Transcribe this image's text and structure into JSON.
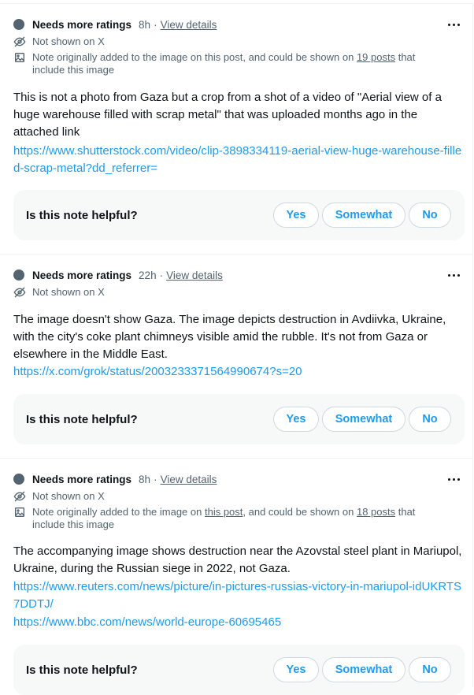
{
  "notes": [
    {
      "status": "Needs more ratings",
      "time": "8h",
      "sep": "·",
      "view_details": "View details",
      "not_shown": "Not shown on X",
      "media_prefix": "Note originally added to the image on this post, and could be shown on ",
      "media_link": "19 posts",
      "media_suffix": " that include this image",
      "body": "This is not a photo from Gaza but a crop from a shot of a video of \"Aerial view of a huge warehouse filled with scrap metal\" that was uploaded months ago in the attached link",
      "links": [
        "https://www.shutterstock.com/video/clip-3898334119-aerial-view-huge-warehouse-filled-scrap-metal?dd_referrer="
      ],
      "question": "Is this note helpful?",
      "yes": "Yes",
      "somewhat": "Somewhat",
      "no": "No"
    },
    {
      "status": "Needs more ratings",
      "time": "22h",
      "sep": "·",
      "view_details": "View details",
      "not_shown": "Not shown on X",
      "body": "The image doesn't show Gaza. The image depicts destruction in Avdiivka, Ukraine, with the city's coke plant chimneys visible amid the rubble. It's not from Gaza or elsewhere in the Middle East.",
      "links": [
        "https://x.com/grok/status/2003233371564990674?s=20"
      ],
      "question": "Is this note helpful?",
      "yes": "Yes",
      "somewhat": "Somewhat",
      "no": "No"
    },
    {
      "status": "Needs more ratings",
      "time": "8h",
      "sep": "·",
      "view_details": "View details",
      "not_shown": "Not shown on X",
      "media_prefix": "Note originally added to the image on ",
      "media_post_link": "this post",
      "media_mid": ", and could be shown on ",
      "media_link": "18 posts",
      "media_suffix": " that include this image",
      "body": "The accompanying image shows destruction near the Azovstal steel plant in Mariupol, Ukraine, during the Russian siege in 2022, not Gaza.",
      "links": [
        "https://www.reuters.com/news/picture/in-pictures-russias-victory-in-mariupol-idUKRTS7DDTJ/",
        "https://www.bbc.com/news/world-europe-60695465"
      ],
      "question": "Is this note helpful?",
      "yes": "Yes",
      "somewhat": "Somewhat",
      "no": "No"
    }
  ]
}
